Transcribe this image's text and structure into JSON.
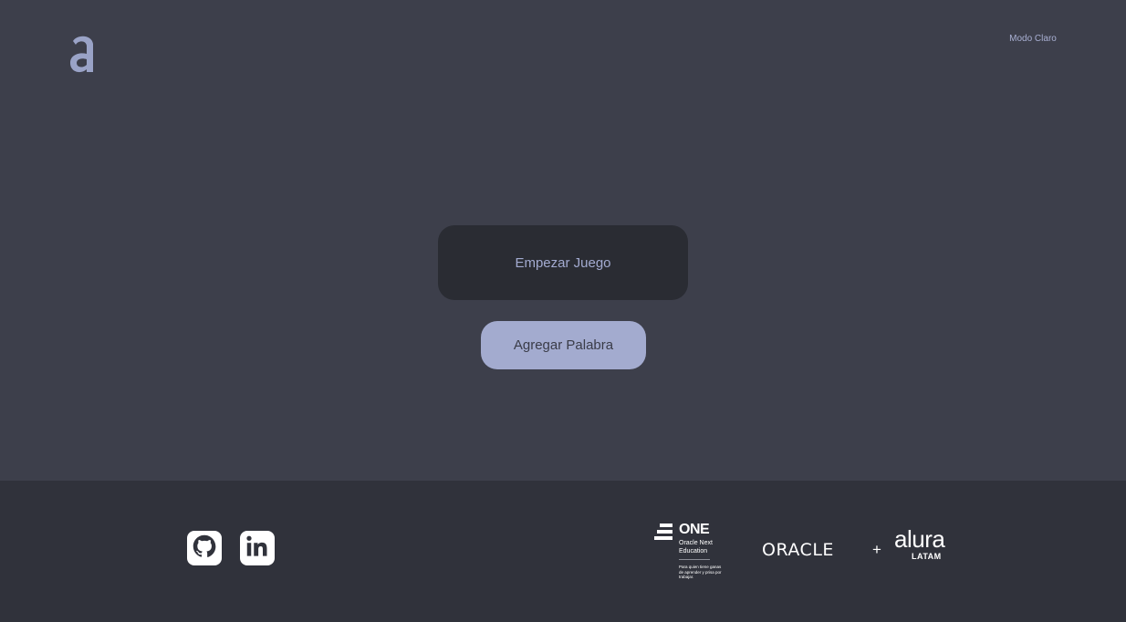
{
  "header": {
    "logo_icon": "alura-a-logo",
    "theme_toggle_label": "Modo Claro"
  },
  "actions": {
    "start_game_label": "Empezar Juego",
    "add_word_label": "Agregar Palabra"
  },
  "footer": {
    "social": [
      {
        "icon": "github-icon"
      },
      {
        "icon": "linkedin-icon"
      }
    ],
    "one": {
      "title": "ONE",
      "subtitle": "Oracle Next Education",
      "tagline": "Para quien tiene ganas de aprender y prisa por trabajar."
    },
    "partners": {
      "oracle": "ORACLE",
      "plus": "+",
      "alura": "alura",
      "latam": "LATAM"
    }
  },
  "colors": {
    "background": "#3d3f4b",
    "footer_background": "#30323b",
    "start_button": "#2a2c33",
    "add_button": "#a3abcf",
    "accent_text": "#a3abd1"
  }
}
